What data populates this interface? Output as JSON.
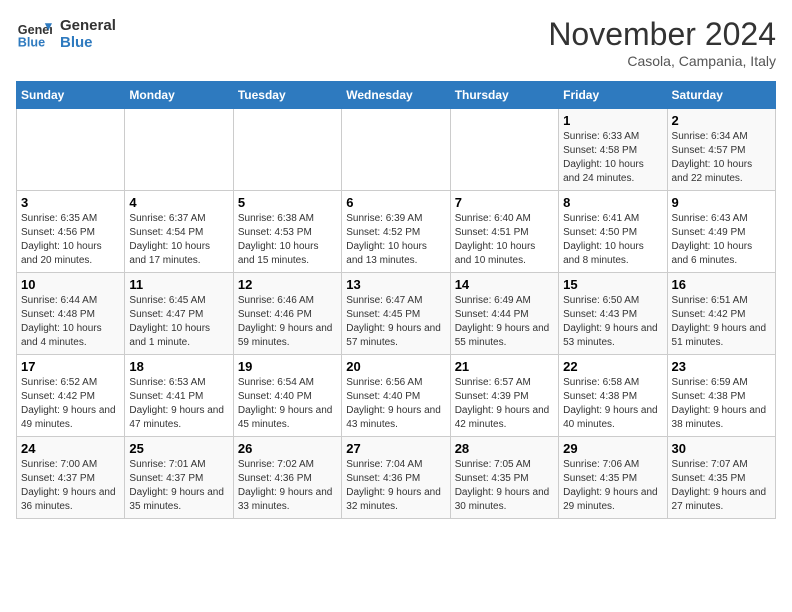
{
  "logo": {
    "text_general": "General",
    "text_blue": "Blue"
  },
  "header": {
    "month": "November 2024",
    "location": "Casola, Campania, Italy"
  },
  "weekdays": [
    "Sunday",
    "Monday",
    "Tuesday",
    "Wednesday",
    "Thursday",
    "Friday",
    "Saturday"
  ],
  "weeks": [
    [
      {
        "day": "",
        "info": ""
      },
      {
        "day": "",
        "info": ""
      },
      {
        "day": "",
        "info": ""
      },
      {
        "day": "",
        "info": ""
      },
      {
        "day": "",
        "info": ""
      },
      {
        "day": "1",
        "info": "Sunrise: 6:33 AM\nSunset: 4:58 PM\nDaylight: 10 hours and 24 minutes."
      },
      {
        "day": "2",
        "info": "Sunrise: 6:34 AM\nSunset: 4:57 PM\nDaylight: 10 hours and 22 minutes."
      }
    ],
    [
      {
        "day": "3",
        "info": "Sunrise: 6:35 AM\nSunset: 4:56 PM\nDaylight: 10 hours and 20 minutes."
      },
      {
        "day": "4",
        "info": "Sunrise: 6:37 AM\nSunset: 4:54 PM\nDaylight: 10 hours and 17 minutes."
      },
      {
        "day": "5",
        "info": "Sunrise: 6:38 AM\nSunset: 4:53 PM\nDaylight: 10 hours and 15 minutes."
      },
      {
        "day": "6",
        "info": "Sunrise: 6:39 AM\nSunset: 4:52 PM\nDaylight: 10 hours and 13 minutes."
      },
      {
        "day": "7",
        "info": "Sunrise: 6:40 AM\nSunset: 4:51 PM\nDaylight: 10 hours and 10 minutes."
      },
      {
        "day": "8",
        "info": "Sunrise: 6:41 AM\nSunset: 4:50 PM\nDaylight: 10 hours and 8 minutes."
      },
      {
        "day": "9",
        "info": "Sunrise: 6:43 AM\nSunset: 4:49 PM\nDaylight: 10 hours and 6 minutes."
      }
    ],
    [
      {
        "day": "10",
        "info": "Sunrise: 6:44 AM\nSunset: 4:48 PM\nDaylight: 10 hours and 4 minutes."
      },
      {
        "day": "11",
        "info": "Sunrise: 6:45 AM\nSunset: 4:47 PM\nDaylight: 10 hours and 1 minute."
      },
      {
        "day": "12",
        "info": "Sunrise: 6:46 AM\nSunset: 4:46 PM\nDaylight: 9 hours and 59 minutes."
      },
      {
        "day": "13",
        "info": "Sunrise: 6:47 AM\nSunset: 4:45 PM\nDaylight: 9 hours and 57 minutes."
      },
      {
        "day": "14",
        "info": "Sunrise: 6:49 AM\nSunset: 4:44 PM\nDaylight: 9 hours and 55 minutes."
      },
      {
        "day": "15",
        "info": "Sunrise: 6:50 AM\nSunset: 4:43 PM\nDaylight: 9 hours and 53 minutes."
      },
      {
        "day": "16",
        "info": "Sunrise: 6:51 AM\nSunset: 4:42 PM\nDaylight: 9 hours and 51 minutes."
      }
    ],
    [
      {
        "day": "17",
        "info": "Sunrise: 6:52 AM\nSunset: 4:42 PM\nDaylight: 9 hours and 49 minutes."
      },
      {
        "day": "18",
        "info": "Sunrise: 6:53 AM\nSunset: 4:41 PM\nDaylight: 9 hours and 47 minutes."
      },
      {
        "day": "19",
        "info": "Sunrise: 6:54 AM\nSunset: 4:40 PM\nDaylight: 9 hours and 45 minutes."
      },
      {
        "day": "20",
        "info": "Sunrise: 6:56 AM\nSunset: 4:40 PM\nDaylight: 9 hours and 43 minutes."
      },
      {
        "day": "21",
        "info": "Sunrise: 6:57 AM\nSunset: 4:39 PM\nDaylight: 9 hours and 42 minutes."
      },
      {
        "day": "22",
        "info": "Sunrise: 6:58 AM\nSunset: 4:38 PM\nDaylight: 9 hours and 40 minutes."
      },
      {
        "day": "23",
        "info": "Sunrise: 6:59 AM\nSunset: 4:38 PM\nDaylight: 9 hours and 38 minutes."
      }
    ],
    [
      {
        "day": "24",
        "info": "Sunrise: 7:00 AM\nSunset: 4:37 PM\nDaylight: 9 hours and 36 minutes."
      },
      {
        "day": "25",
        "info": "Sunrise: 7:01 AM\nSunset: 4:37 PM\nDaylight: 9 hours and 35 minutes."
      },
      {
        "day": "26",
        "info": "Sunrise: 7:02 AM\nSunset: 4:36 PM\nDaylight: 9 hours and 33 minutes."
      },
      {
        "day": "27",
        "info": "Sunrise: 7:04 AM\nSunset: 4:36 PM\nDaylight: 9 hours and 32 minutes."
      },
      {
        "day": "28",
        "info": "Sunrise: 7:05 AM\nSunset: 4:35 PM\nDaylight: 9 hours and 30 minutes."
      },
      {
        "day": "29",
        "info": "Sunrise: 7:06 AM\nSunset: 4:35 PM\nDaylight: 9 hours and 29 minutes."
      },
      {
        "day": "30",
        "info": "Sunrise: 7:07 AM\nSunset: 4:35 PM\nDaylight: 9 hours and 27 minutes."
      }
    ]
  ]
}
